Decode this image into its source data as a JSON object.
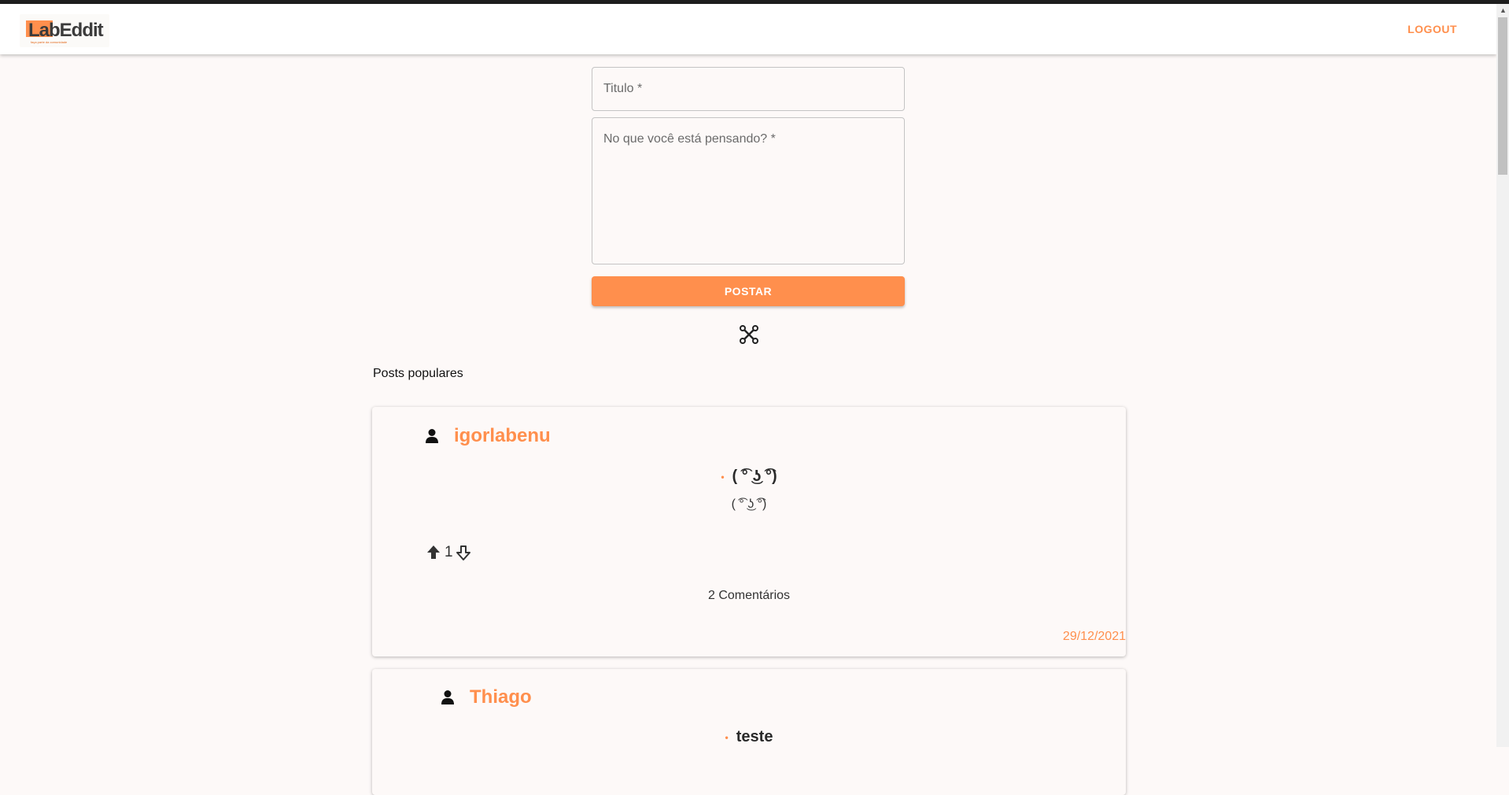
{
  "app": {
    "logo_text": "LabEddit",
    "logo_tagline": "faça parte da comunidade",
    "logout_label": "LOGOUT"
  },
  "form": {
    "title_placeholder": "Titulo *",
    "body_placeholder": "No que você está pensando? *",
    "submit_label": "POSTAR"
  },
  "feed": {
    "section_title": "Posts populares",
    "posts": [
      {
        "username": "igorlabenu",
        "title": "( ͡° ͜ʖ ͡°)",
        "body": "( ͡° ͜ʖ ͡°)",
        "votes": "1",
        "comments": "2 Comentários",
        "date": "29/12/2021",
        "user_vote": "up"
      },
      {
        "username": "Thiago",
        "title": "teste"
      }
    ]
  },
  "colors": {
    "accent": "#ff8f4d",
    "background": "#fdf9f8",
    "appbar": "#ffffff"
  },
  "icons": [
    "user-icon",
    "upvote-arrow-icon",
    "downvote-arrow-icon",
    "close-icon"
  ]
}
